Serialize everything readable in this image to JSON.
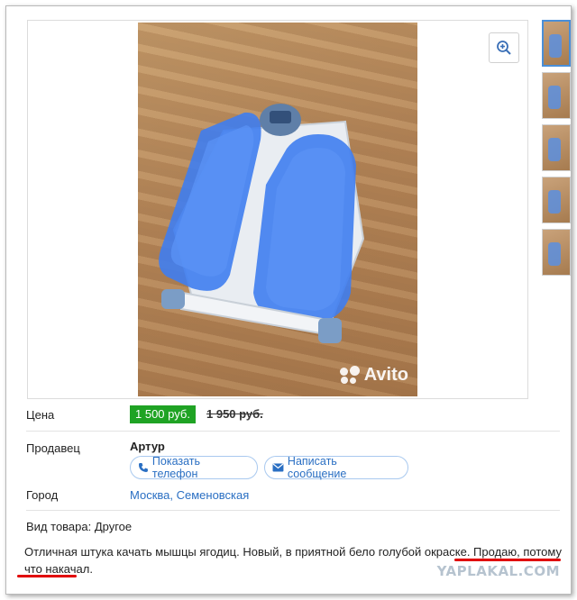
{
  "listing": {
    "price_label": "Цена",
    "price": "1 500 руб.",
    "old_price": "1 950 руб.",
    "seller_label": "Продавец",
    "seller_name": "Артур",
    "show_phone_label": "Показать телефон",
    "write_message_label": "Написать сообщение",
    "city_label": "Город",
    "city_value": "Москва, Семеновская",
    "item_type": "Вид товара: Другое",
    "description_part1": "Отличная штука качать мышцы ягодиц. Новый, в приятной бело голубой окраске. ",
    "description_part2": "Продаю, потому что накачал."
  },
  "gallery": {
    "watermark": "Avito",
    "zoom_icon": "zoom-in-icon",
    "thumbnail_count": 5
  },
  "site_watermark": "YAPLAKAL.COM",
  "colors": {
    "price_badge": "#1fa324",
    "link": "#2a6fc3",
    "annotation_underline": "#e10000"
  }
}
